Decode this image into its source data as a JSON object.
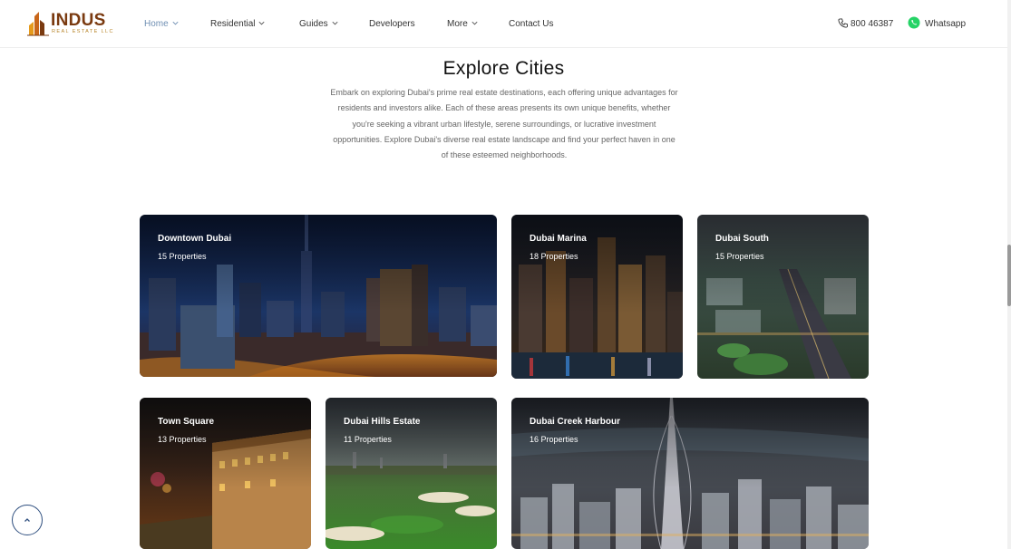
{
  "header": {
    "logo": {
      "name": "INDUS",
      "tagline": "REAL ESTATE LLC"
    },
    "nav": [
      {
        "label": "Home",
        "active": true,
        "has_dropdown": true
      },
      {
        "label": "Residential",
        "active": false,
        "has_dropdown": true
      },
      {
        "label": "Guides",
        "active": false,
        "has_dropdown": true
      },
      {
        "label": "Developers",
        "active": false,
        "has_dropdown": false
      },
      {
        "label": "More",
        "active": false,
        "has_dropdown": true
      },
      {
        "label": "Contact Us",
        "active": false,
        "has_dropdown": false
      }
    ],
    "phone": {
      "icon": "phone-icon",
      "number": "800 46387"
    },
    "whatsapp": {
      "icon": "whatsapp-icon",
      "label": "Whatsapp"
    }
  },
  "section": {
    "title": "Explore Cities",
    "description": "Embark on exploring Dubai's prime real estate destinations, each offering unique advantages for residents and investors alike. Each of these areas presents its own unique benefits, whether you're seeking a vibrant urban lifestyle, serene surroundings, or lucrative investment opportunities. Explore Dubai's diverse real estate landscape and find your perfect haven in one of these esteemed neighborhoods."
  },
  "cities": [
    {
      "name": "Downtown Dubai",
      "count": "15 Properties"
    },
    {
      "name": "Dubai Marina",
      "count": "18 Properties"
    },
    {
      "name": "Dubai South",
      "count": "15 Properties"
    },
    {
      "name": "Town Square",
      "count": "13 Properties"
    },
    {
      "name": "Dubai Hills Estate",
      "count": "11 Properties"
    },
    {
      "name": "Dubai Creek Harbour",
      "count": "16 Properties"
    }
  ],
  "colors": {
    "brand": "#7a3a10",
    "accent_gold": "#e59a1c",
    "nav_active": "#6f8fb3",
    "whatsapp": "#25d366",
    "back_to_top": "#2f4f7f"
  },
  "back_to_top": {
    "icon": "chevron-up-icon"
  }
}
